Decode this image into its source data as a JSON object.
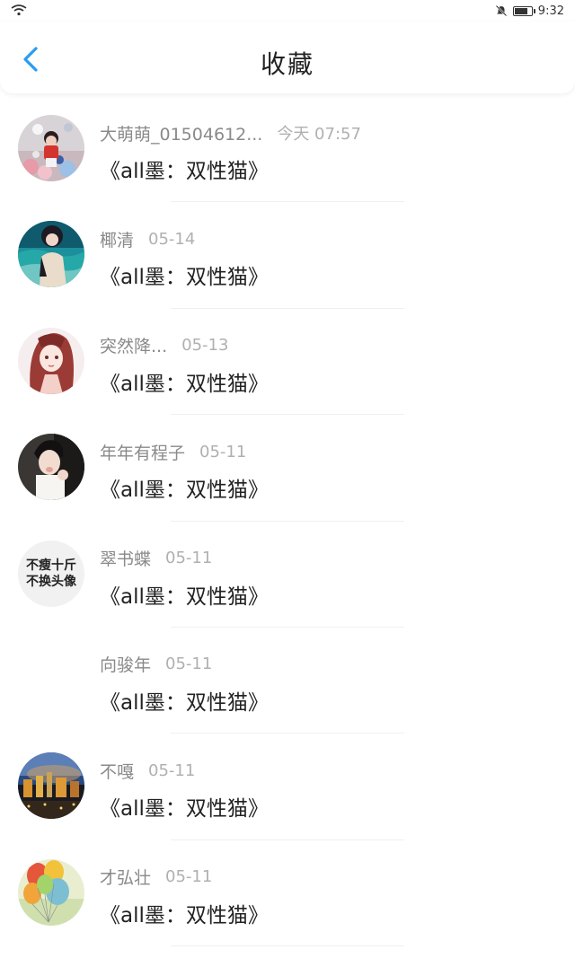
{
  "status_bar": {
    "time": "9:32",
    "battery_level": 0.85
  },
  "header": {
    "title": "收藏"
  },
  "items": [
    {
      "user": "大萌萌_01504612...",
      "date": "今天 07:57",
      "title": "《all墨：双性猫》",
      "avatar": "party-photo"
    },
    {
      "user": "椰清",
      "date": "05-14",
      "title": "《all墨：双性猫》",
      "avatar": "ocean-portrait"
    },
    {
      "user": "突然降...",
      "date": "05-13",
      "title": "《all墨：双性猫》",
      "avatar": "anime-girl"
    },
    {
      "user": "年年有程子",
      "date": "05-11",
      "title": "《all墨：双性猫》",
      "avatar": "boy-portrait"
    },
    {
      "user": "翠书蝶",
      "date": "05-11",
      "title": "《all墨：双性猫》",
      "avatar": "text-avatar",
      "avatar_text": [
        "不瘦十斤",
        "不换头像"
      ]
    },
    {
      "user": "向骏年",
      "date": "05-11",
      "title": "《all墨：双性猫》",
      "avatar": "none"
    },
    {
      "user": "不嘎",
      "date": "05-11",
      "title": "《all墨：双性猫》",
      "avatar": "night-city"
    },
    {
      "user": "才弘壮",
      "date": "05-11",
      "title": "《all墨：双性猫》",
      "avatar": "balloons"
    }
  ]
}
